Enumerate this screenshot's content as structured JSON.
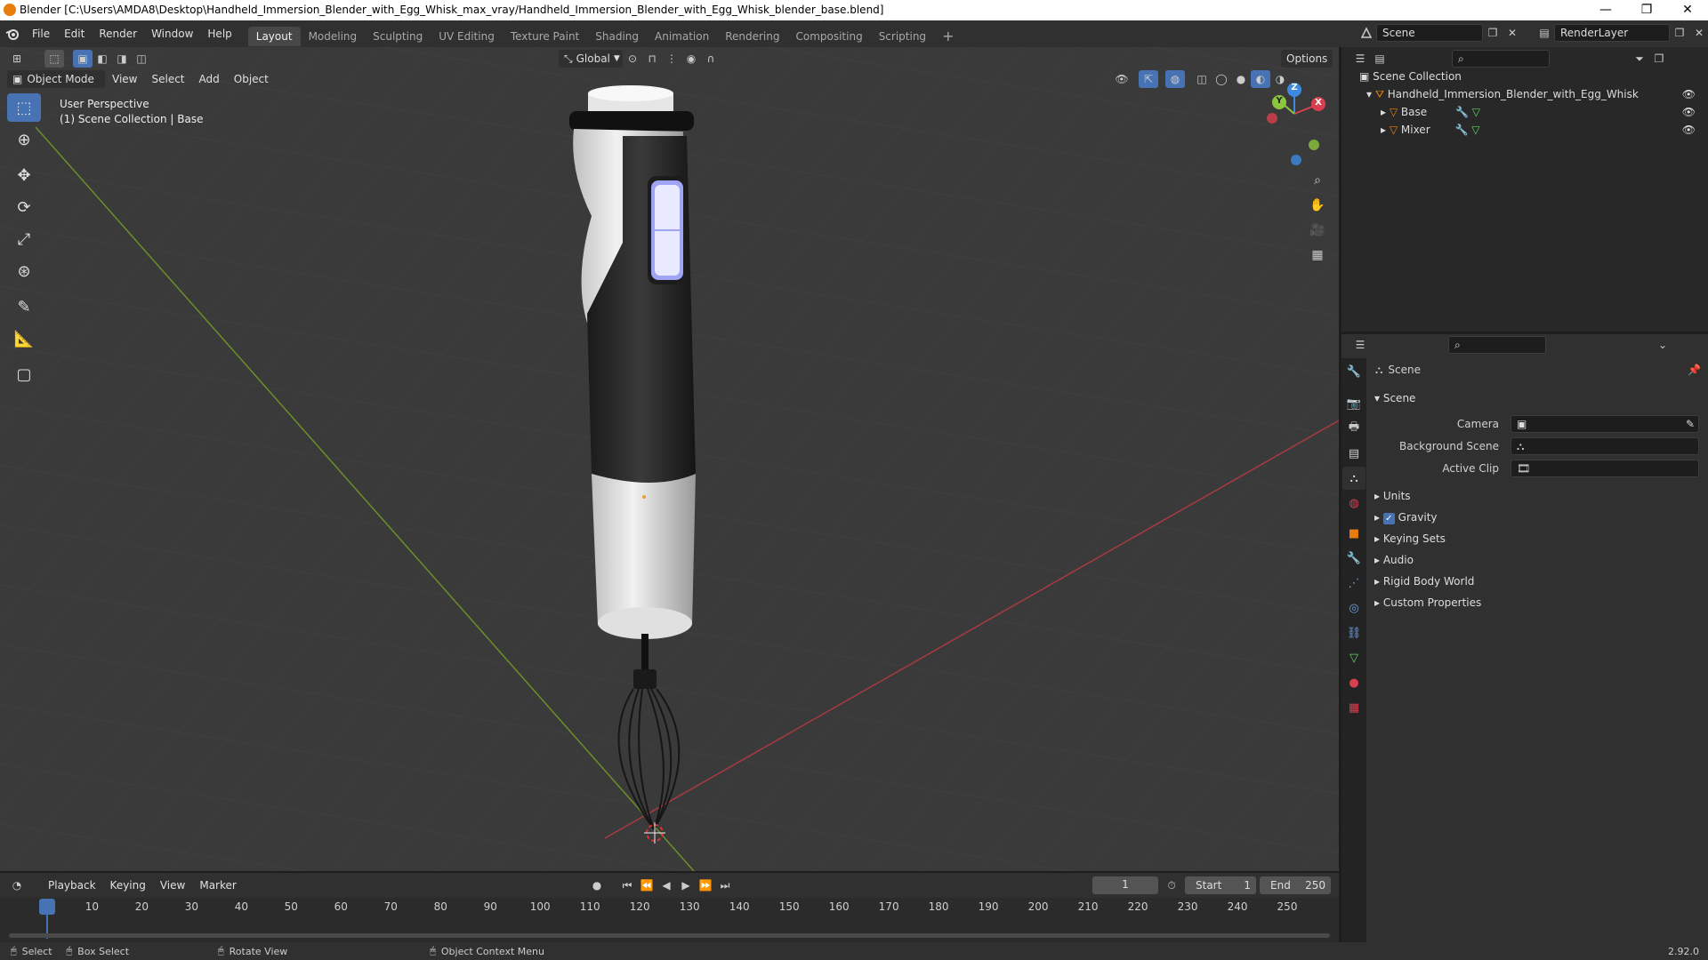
{
  "titlebar": {
    "title": "Blender [C:\\Users\\AMDA8\\Desktop\\Handheld_Immersion_Blender_with_Egg_Whisk_max_vray/Handheld_Immersion_Blender_with_Egg_Whisk_blender_base.blend]",
    "minimize": "—",
    "maximize": "❐",
    "close": "✕"
  },
  "menubar": {
    "menus": [
      "File",
      "Edit",
      "Render",
      "Window",
      "Help"
    ],
    "workspaces": [
      "Layout",
      "Modeling",
      "Sculpting",
      "UV Editing",
      "Texture Paint",
      "Shading",
      "Animation",
      "Rendering",
      "Compositing",
      "Scripting"
    ],
    "add_tab": "+",
    "scene_name": "Scene",
    "view_layer": "RenderLayer"
  },
  "viewport": {
    "mode": "Object Mode",
    "menus": [
      "View",
      "Select",
      "Add",
      "Object"
    ],
    "transform_orientation": "Global",
    "options_label": "Options",
    "perspective_label": "User Perspective",
    "collection_label": "(1) Scene Collection | Base",
    "gizmo": {
      "x": "X",
      "y": "Y",
      "z": "Z"
    }
  },
  "outliner": {
    "root": "Scene Collection",
    "collection": "Handheld_Immersion_Blender_with_Egg_Whisk",
    "objects": [
      "Base",
      "Mixer"
    ]
  },
  "properties": {
    "context": "Scene",
    "panel_title": "Scene",
    "fields": [
      {
        "label": "Camera",
        "value": ""
      },
      {
        "label": "Background Scene",
        "value": ""
      },
      {
        "label": "Active Clip",
        "value": ""
      }
    ],
    "subpanels": [
      "Units",
      "Gravity",
      "Keying Sets",
      "Audio",
      "Rigid Body World",
      "Custom Properties"
    ],
    "gravity_checked": true
  },
  "timeline": {
    "menus": [
      "Playback",
      "Keying",
      "View",
      "Marker"
    ],
    "current_frame": "1",
    "start_label": "Start",
    "start_value": "1",
    "end_label": "End",
    "end_value": "250",
    "ticks": [
      "1",
      "10",
      "20",
      "30",
      "40",
      "50",
      "60",
      "70",
      "80",
      "90",
      "100",
      "110",
      "120",
      "130",
      "140",
      "150",
      "160",
      "170",
      "180",
      "190",
      "200",
      "210",
      "220",
      "230",
      "240",
      "250"
    ]
  },
  "statusbar": {
    "select": "Select",
    "box_select": "Box Select",
    "rotate_view": "Rotate View",
    "context_menu": "Object Context Menu",
    "version": "2.92.0"
  },
  "colors": {
    "accent": "#4772b3",
    "x_axis": "#d9404f",
    "y_axis": "#8cc63f",
    "z_axis": "#3d8ae0",
    "object_orange": "#e87d0d"
  }
}
